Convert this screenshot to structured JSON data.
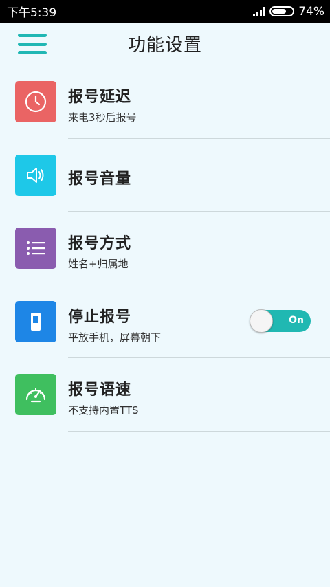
{
  "status_bar": {
    "time": "下午5:39",
    "battery": "74%"
  },
  "header": {
    "title": "功能设置"
  },
  "items": [
    {
      "title": "报号延迟",
      "subtitle": "来电3秒后报号",
      "icon": "clock-icon",
      "color": "#ea6464"
    },
    {
      "title": "报号音量",
      "subtitle": "",
      "icon": "speaker-icon",
      "color": "#1ec8e8"
    },
    {
      "title": "报号方式",
      "subtitle": "姓名+归属地",
      "icon": "list-icon",
      "color": "#8a5caf"
    },
    {
      "title": "停止报号",
      "subtitle": "平放手机，屏幕朝下",
      "icon": "phone-icon",
      "color": "#1e86e6"
    },
    {
      "title": "报号语速",
      "subtitle": "不支持内置TTS",
      "icon": "speedometer-icon",
      "color": "#3fbf5f"
    }
  ],
  "toggle": {
    "label": "On",
    "state": "on"
  }
}
